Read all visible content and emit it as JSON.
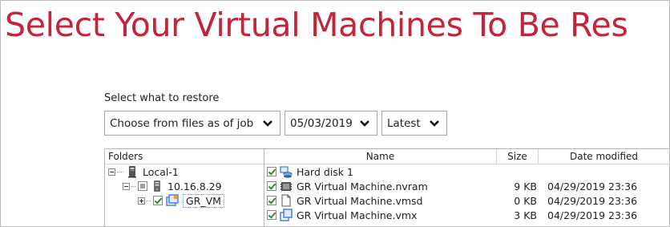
{
  "title": "Select Your Virtual Machines To Be Res",
  "restore_label": "Select what to restore",
  "dropdowns": {
    "job": "Choose from files as of job",
    "date": "05/03/2019",
    "version": "Latest"
  },
  "folders": {
    "header": "Folders",
    "tree": [
      {
        "label": "Local-1",
        "icon": "computer-icon"
      },
      {
        "label": "10.16.8.29",
        "icon": "server-icon"
      },
      {
        "label": "GR_VM",
        "icon": "virtual-machine-icon"
      }
    ]
  },
  "files": {
    "headers": {
      "name": "Name",
      "size": "Size",
      "date": "Date modified"
    },
    "rows": [
      {
        "name": "Hard disk 1",
        "size": "",
        "date": "",
        "icon": "hard-disk-icon"
      },
      {
        "name": "GR Virtual Machine.nvram",
        "size": "9 KB",
        "date": "04/29/2019 23:36",
        "icon": "nvram-file-icon"
      },
      {
        "name": "GR Virtual Machine.vmsd",
        "size": "0 KB",
        "date": "04/29/2019 23:36",
        "icon": "document-file-icon"
      },
      {
        "name": "GR Virtual Machine.vmx",
        "size": "3 KB",
        "date": "04/29/2019 23:36",
        "icon": "vmx-file-icon"
      }
    ]
  },
  "colors": {
    "title": "#c4243a",
    "check": "#2e8b2e"
  }
}
